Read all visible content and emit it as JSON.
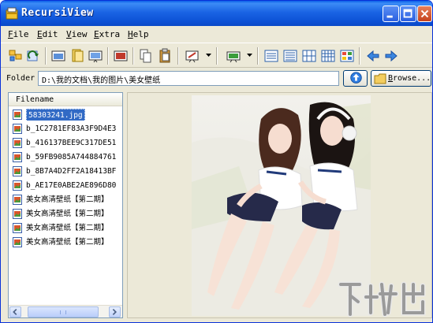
{
  "window": {
    "title": "RecursiView"
  },
  "menu": [
    "File",
    "Edit",
    "View",
    "Extra",
    "Help"
  ],
  "toolbar": {
    "buttons": [
      "thumbnails-icon",
      "refresh-icon",
      "first-image-icon",
      "open-folder-icon",
      "slideshow-icon",
      "fullscreen-icon",
      "copy-icon",
      "paste-icon",
      "settings-icon",
      "export-icon",
      "view-details-icon",
      "view-list-icon",
      "view-small-icon",
      "view-medium-icon",
      "view-large-icon",
      "back-arrow-icon",
      "forward-arrow-icon"
    ]
  },
  "folder": {
    "label": "Folder",
    "path": "D:\\我的文档\\我的图片\\美女壁纸",
    "browse_label": "Browse..."
  },
  "file_list": {
    "header": "Filename",
    "selected_index": 0,
    "items": [
      "58303241.jpg",
      "b_1C2781EF83A3F9D4E3",
      "b_416137BEE9C317DE51",
      "b_59FB9085A744884761",
      "b_8B7A4D2FF2A18413BF",
      "b_AE17E0ABE2AE896D80",
      "美女高清壁纸【第二期】",
      "美女高清壁纸【第二期】",
      "美女高清壁纸【第二期】",
      "美女高清壁纸【第二期】"
    ]
  },
  "watermark": {
    "text": "下载吧",
    "url": "www.xiazaiba.com"
  },
  "colors": {
    "titlebar": "#0a5ee8",
    "selection": "#316ac5",
    "chrome": "#ece9d8"
  }
}
